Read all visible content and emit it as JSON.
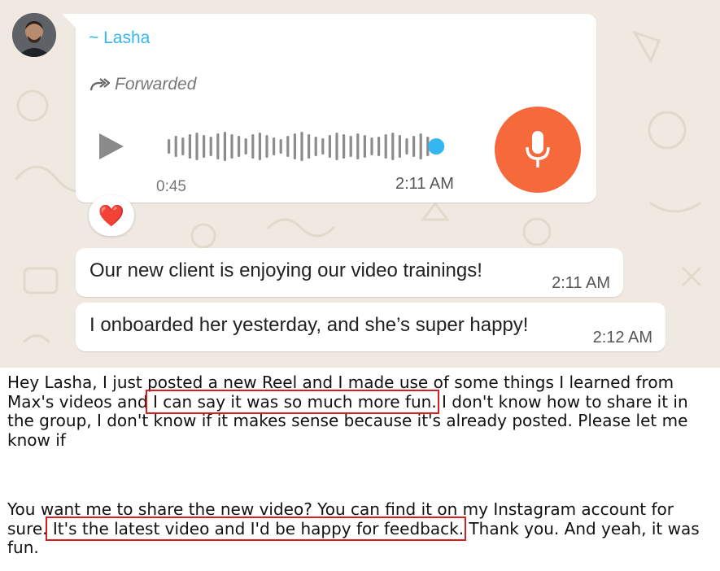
{
  "chat": {
    "sender": "~ Lasha",
    "forwarded_label": "Forwarded",
    "voice": {
      "duration": "0:45",
      "time": "2:11 AM",
      "progress": 1.0
    },
    "reaction": "❤️",
    "messages": [
      {
        "text": "Our new client is enjoying our video trainings!",
        "time": "2:11 AM"
      },
      {
        "text": "I onboarded her yesterday, and she’s super happy!",
        "time": "2:12 AM"
      }
    ],
    "icons": {
      "play": "play-icon",
      "mic": "microphone-icon",
      "forward": "forward-icon",
      "avatar": "avatar-image"
    },
    "colors": {
      "accent_name": "#34b7f1",
      "mic_button": "#f5693b",
      "wave_dot": "#34b7f1",
      "bubble": "#ffffff",
      "background": "#efe9e1"
    }
  },
  "notes": {
    "p1": {
      "before": "Hey Lasha, I just posted a new Reel and I made use of some things I learned from Max's videos and",
      "highlight": " I can say it was so much more fun.",
      "after": " I don't know how to share it in the group, I don't know if it makes sense because it's already posted. Please let me know if"
    },
    "p2": {
      "before": "You want me to share the new video? You can find it on my Instagram account for sure.",
      "highlight": " It's the latest video and I'd be happy for feedback.",
      "after": " Thank you. And yeah, it was fun."
    }
  }
}
